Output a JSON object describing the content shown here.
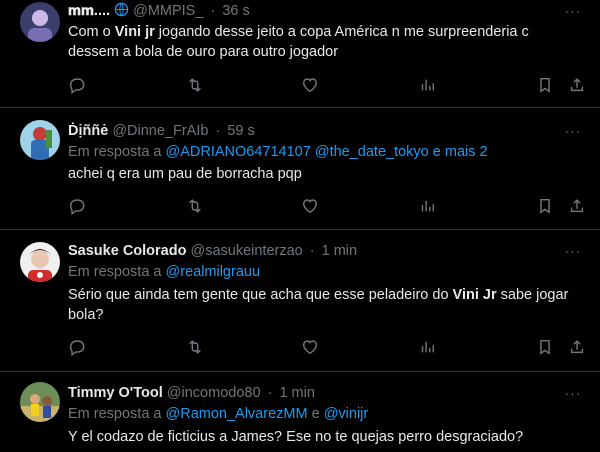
{
  "tweets": [
    {
      "display_name": "𝐦𝐦....",
      "handle": "@MMPIS_",
      "time": "36 s",
      "reply_prefix": "",
      "reply_links": [],
      "text_parts": [
        {
          "t": "Com o ",
          "bold": false
        },
        {
          "t": "Vini jr",
          "bold": true
        },
        {
          "t": " jogando desse jeito a copa América n me surpreenderia c dessem a bola de ouro para outro jogador",
          "bold": false
        }
      ]
    },
    {
      "display_name": "Ḋịññė",
      "handle": "@Dinne_FrAIb",
      "time": "59 s",
      "reply_prefix": "Em resposta a ",
      "reply_links": [
        "@ADRIANO64714107",
        "@the_date_tokyo",
        "e mais 2"
      ],
      "text_parts": [
        {
          "t": "achei q era um pau de borracha pqp",
          "bold": false
        }
      ]
    },
    {
      "display_name": "Sasuke Colorado",
      "handle": "@sasukeinterzao",
      "time": "1 min",
      "reply_prefix": "Em resposta a ",
      "reply_links": [
        "@realmilgrauu"
      ],
      "text_parts": [
        {
          "t": "Sério que ainda tem gente que acha que esse peladeiro do ",
          "bold": false
        },
        {
          "t": "Vini Jr",
          "bold": true
        },
        {
          "t": " sabe jogar bola?",
          "bold": false
        }
      ]
    },
    {
      "display_name": "Timmy O'Tool",
      "handle": "@incomodo80",
      "time": "1 min",
      "reply_prefix": "Em resposta a ",
      "reply_links": [
        "@Ramon_AlvarezMM",
        "e",
        "@vinijr"
      ],
      "text_parts": [
        {
          "t": "Y el codazo de ficticius a James? Ese no te quejas perro desgraciado?",
          "bold": false
        }
      ]
    }
  ],
  "icons": [
    "reply-icon",
    "retweet-icon",
    "like-icon",
    "views-icon",
    "bookmark-icon",
    "share-icon",
    "more-icon"
  ],
  "colors": {
    "background": "#000000",
    "text": "#e7e9ea",
    "muted": "#71767b",
    "link": "#1d9bf0",
    "divider": "#2f3336"
  }
}
